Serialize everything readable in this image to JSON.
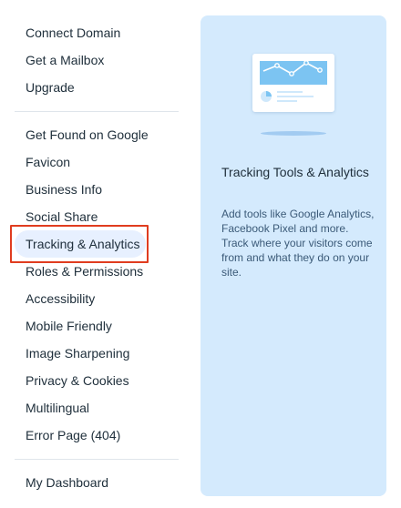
{
  "menu": {
    "group1": [
      {
        "label": "Connect Domain"
      },
      {
        "label": "Get a Mailbox"
      },
      {
        "label": "Upgrade"
      }
    ],
    "group2": [
      {
        "label": "Get Found on Google"
      },
      {
        "label": "Favicon"
      },
      {
        "label": "Business Info"
      },
      {
        "label": "Social Share"
      },
      {
        "label": "Tracking & Analytics"
      },
      {
        "label": "Roles & Permissions"
      },
      {
        "label": "Accessibility"
      },
      {
        "label": "Mobile Friendly"
      },
      {
        "label": "Image Sharpening"
      },
      {
        "label": "Privacy & Cookies"
      },
      {
        "label": "Multilingual"
      },
      {
        "label": "Error Page (404)"
      }
    ],
    "group3": [
      {
        "label": "My Dashboard"
      }
    ],
    "highlighted": "Tracking & Analytics"
  },
  "panel": {
    "title": "Tracking Tools & Analytics",
    "description": "Add tools like Google Analytics, Facebook Pixel and more. Track where your visitors come from and what they do on your site.",
    "illustration_icon": "analytics-dashboard-icon",
    "background_color": "#d4eafd"
  },
  "colors": {
    "highlight_bg": "#e7f0ff",
    "annotation_border": "#e03c1f",
    "chart_line": "#ffffff",
    "chart_bg": "#7cc4f2"
  }
}
